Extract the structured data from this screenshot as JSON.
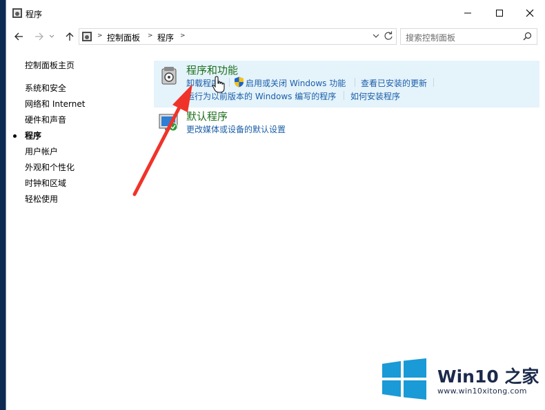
{
  "window": {
    "title": "程序"
  },
  "nav": {
    "back_icon": "back-arrow-icon",
    "forward_icon": "forward-arrow-icon",
    "recent_icon": "chevron-down-icon",
    "up_icon": "up-arrow-icon"
  },
  "address": {
    "crumbs": [
      "控制面板",
      "程序"
    ]
  },
  "search": {
    "placeholder": "搜索控制面板"
  },
  "sidebar": {
    "home": "控制面板主页",
    "items": [
      {
        "label": "系统和安全"
      },
      {
        "label": "网络和 Internet"
      },
      {
        "label": "硬件和声音"
      },
      {
        "label": "程序"
      },
      {
        "label": "用户帐户"
      },
      {
        "label": "外观和个性化"
      },
      {
        "label": "时钟和区域"
      },
      {
        "label": "轻松使用"
      }
    ]
  },
  "categories": [
    {
      "title": "程序和功能",
      "links": [
        "卸载程序",
        "启用或关闭 Windows 功能",
        "查看已安装的更新",
        "运行为以前版本的 Windows 编写的程序",
        "如何安装程序"
      ]
    },
    {
      "title": "默认程序",
      "links": [
        "更改媒体或设备的默认设置"
      ]
    }
  ],
  "watermark": {
    "brand": "Win10 之家",
    "url": "www.win10xitong.com"
  },
  "colors": {
    "category_title": "#1e6f1e",
    "link": "#1a5ea8",
    "highlight": "#e5f3fb",
    "arrow": "#f0332a",
    "win_logo": "#1a9ad6"
  }
}
